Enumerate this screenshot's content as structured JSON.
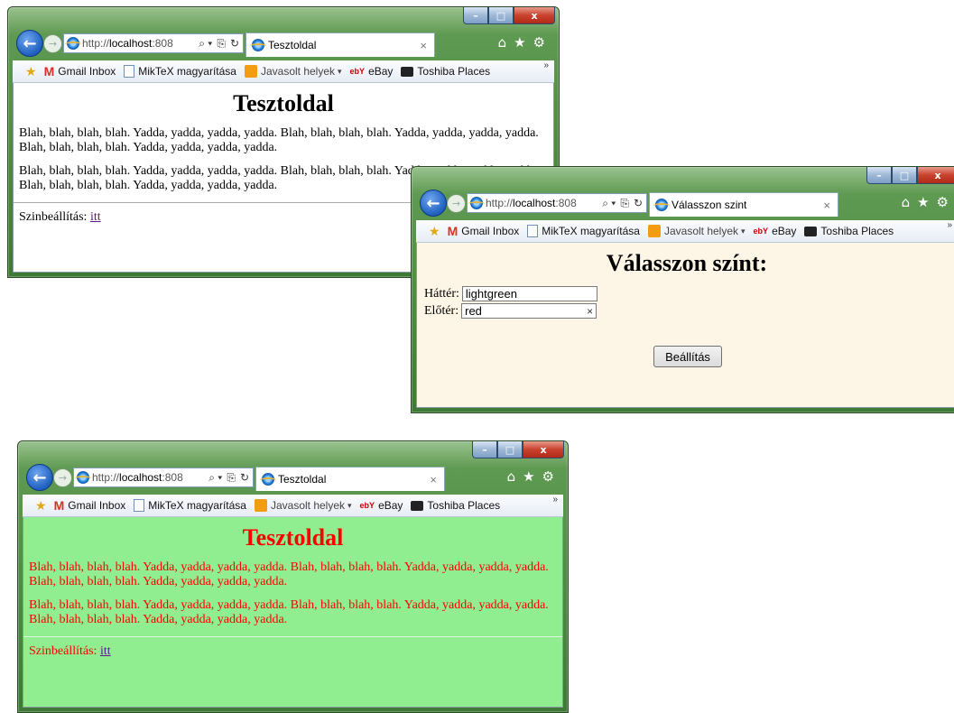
{
  "browser": {
    "url_host": "http://",
    "url_bold": "localhost",
    "url_rest": ":808",
    "caption_min": "–",
    "caption_max": "□",
    "caption_close": "x",
    "back_glyph": "←",
    "forward_glyph": "→",
    "search_glyph": "⌕ ▾",
    "compat_glyph": "⎘",
    "refresh_glyph": "↻",
    "home_glyph": "⌂",
    "favorites_glyph": "★",
    "gear_glyph": "⚙",
    "tab_close_glyph": "×"
  },
  "favorites_bar": {
    "items": [
      {
        "label": "Gmail Inbox",
        "icon": "gmail-icon",
        "glyph": "M"
      },
      {
        "label": "MikTeX magyarítása",
        "icon": "page-icon"
      },
      {
        "label": "Javasolt helyek",
        "icon": "suggested-sites-icon"
      },
      {
        "label": "eBay",
        "icon": "ebay-icon",
        "glyph": "ebY"
      },
      {
        "label": "Toshiba Places",
        "icon": "toshiba-icon"
      }
    ],
    "dropdown_arrow": "▾",
    "chevron": "»"
  },
  "windows": {
    "w1": {
      "tab_title": "Tesztoldal",
      "heading": "Tesztoldal",
      "para1": "Blah, blah, blah, blah. Yadda, yadda, yadda, yadda. Blah, blah, blah, blah. Yadda, yadda, yadda, yadda. Blah, blah, blah, blah. Yadda, yadda, yadda, yadda.",
      "para2": "Blah, blah, blah, blah. Yadda, yadda, yadda, yadda. Blah, blah, blah, blah. Yadda, yadda, yadda, yadda. Blah, blah, blah, blah. Yadda, yadda, yadda, yadda.",
      "color_label": "Szinbeállítás:",
      "color_link": "itt"
    },
    "w2": {
      "tab_title": "Válasszon szint",
      "heading": "Válasszon színt:",
      "bg_label": "Háttér:",
      "bg_value": "lightgreen",
      "fg_label": "Előtér:",
      "fg_value": "red",
      "clear_glyph": "×",
      "submit_label": "Beállítás"
    },
    "w3": {
      "tab_title": "Tesztoldal",
      "heading": "Tesztoldal",
      "para1": "Blah, blah, blah, blah. Yadda, yadda, yadda, yadda. Blah, blah, blah, blah. Yadda, yadda, yadda, yadda. Blah, blah, blah, blah. Yadda, yadda, yadda, yadda.",
      "para2": "Blah, blah, blah, blah. Yadda, yadda, yadda, yadda. Blah, blah, blah, blah. Yadda, yadda, yadda, yadda. Blah, blah, blah, blah. Yadda, yadda, yadda, yadda.",
      "color_label": "Szinbeállítás:",
      "color_link": "itt"
    }
  },
  "colors": {
    "page_bg_default": "#ffffff",
    "form_bg": "#fdf5e6",
    "page_bg_applied": "#90ee90",
    "text_applied": "#ff0000",
    "link_visited": "#551a8b"
  }
}
